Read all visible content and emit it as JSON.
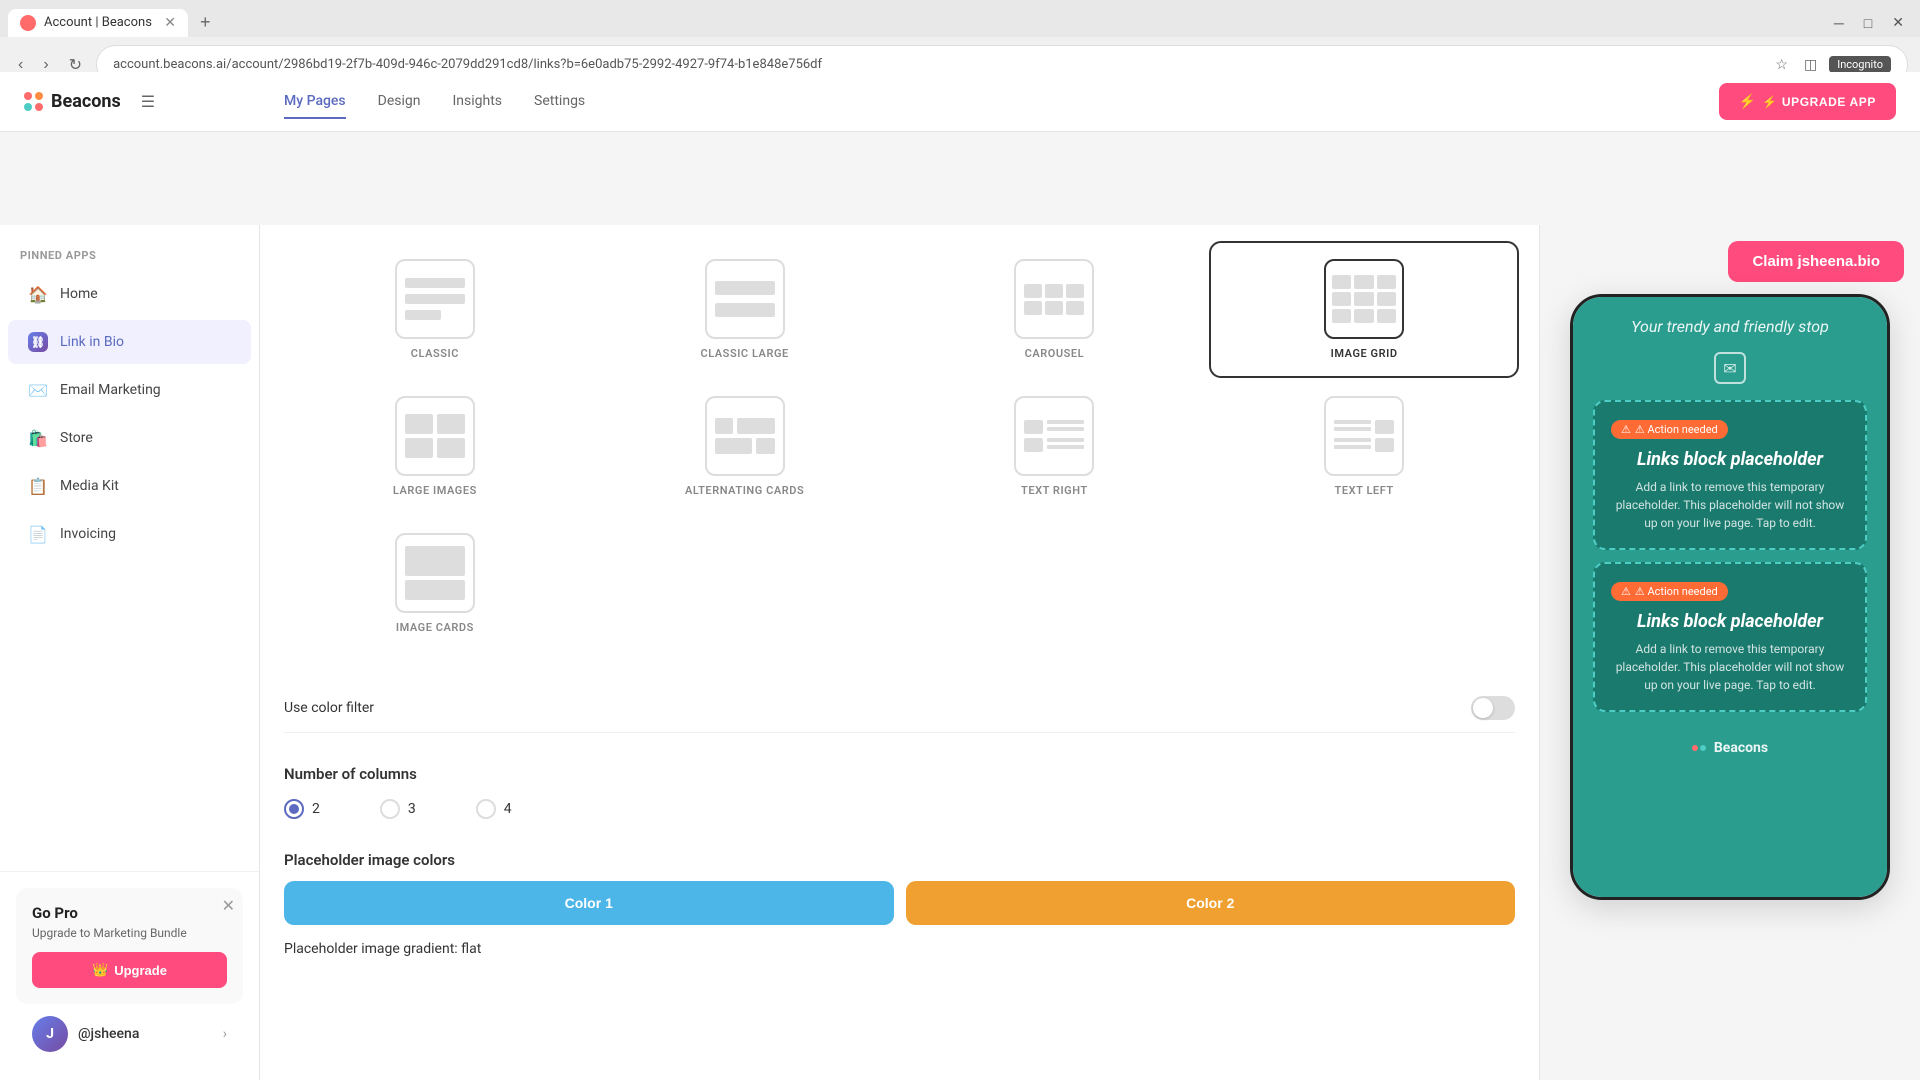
{
  "browser": {
    "tab_title": "Account | Beacons",
    "url": "account.beacons.ai/account/2986bd19-2f7b-409d-946c-2079dd291cd8/links?b=6e0adb75-2992-4927-9f74-b1e848e756df",
    "new_tab_btn": "+",
    "incognito_label": "Incognito"
  },
  "top_nav": {
    "logo_text": "Beacons",
    "tabs": [
      {
        "label": "My Pages",
        "active": true
      },
      {
        "label": "Design",
        "active": false
      },
      {
        "label": "Insights",
        "active": false
      },
      {
        "label": "Settings",
        "active": false
      }
    ],
    "upgrade_btn": "⚡ UPGRADE APP"
  },
  "sidebar": {
    "section_label": "PINNED APPS",
    "items": [
      {
        "label": "Home",
        "icon": "🏠",
        "active": false
      },
      {
        "label": "Link in Bio",
        "icon": "🔗",
        "active": true
      },
      {
        "label": "Email Marketing",
        "icon": "✉️",
        "active": false
      },
      {
        "label": "Store",
        "icon": "🛍️",
        "active": false
      },
      {
        "label": "Media Kit",
        "icon": "📋",
        "active": false
      },
      {
        "label": "Invoicing",
        "icon": "📄",
        "active": false
      }
    ],
    "go_pro": {
      "title": "Go Pro",
      "description": "Upgrade to Marketing Bundle",
      "upgrade_btn": "👑 Upgrade"
    },
    "user": {
      "name": "@jsheena",
      "initials": "J"
    }
  },
  "layout_options": [
    {
      "id": "classic",
      "label": "CLASSIC",
      "selected": false
    },
    {
      "id": "classic-large",
      "label": "CLASSIC LARGE",
      "selected": false
    },
    {
      "id": "carousel",
      "label": "CAROUSEL",
      "selected": false
    },
    {
      "id": "image-grid",
      "label": "IMAGE GRID",
      "selected": true
    },
    {
      "id": "large-images",
      "label": "LARGE IMAGES",
      "selected": false
    },
    {
      "id": "alternating-cards",
      "label": "ALTERNATING CARDS",
      "selected": false
    },
    {
      "id": "text-right",
      "label": "TEXT RIGHT",
      "selected": false
    },
    {
      "id": "text-left",
      "label": "TEXT LEFT",
      "selected": false
    },
    {
      "id": "image-cards",
      "label": "IMAGE CARDS",
      "selected": false
    }
  ],
  "settings": {
    "color_filter_label": "Use color filter",
    "color_filter_on": false,
    "columns_title": "Number of columns",
    "columns_options": [
      "2",
      "3",
      "4"
    ],
    "columns_selected": "2",
    "colors_title": "Placeholder image colors",
    "color1_label": "Color 1",
    "color2_label": "Color 2",
    "gradient_label": "Placeholder image gradient: flat"
  },
  "preview": {
    "claim_btn": "Claim jsheena.bio",
    "phone_header": "Your trendy and friendly stop",
    "card1": {
      "badge": "⚠ Action needed",
      "title": "Links block placeholder",
      "desc": "Add a link to remove this temporary placeholder. This placeholder will not show up on your live page. Tap to edit."
    },
    "card2": {
      "badge": "⚠ Action needed",
      "title": "Links block placeholder",
      "desc": "Add a link to remove this temporary placeholder. This placeholder will not show up on your live page. Tap to edit."
    },
    "footer_text": "Beacons"
  },
  "colors": {
    "active_tab": "#5c6bc0",
    "upgrade_btn": "#ff4b7d",
    "selected_border": "#333333",
    "color1": "#4db6e8",
    "color2": "#f0a030",
    "phone_bg": "#2a9d8f",
    "card_bg": "#1a7a6e",
    "card_border": "#4ecdc4",
    "action_badge": "#ff6b35"
  }
}
